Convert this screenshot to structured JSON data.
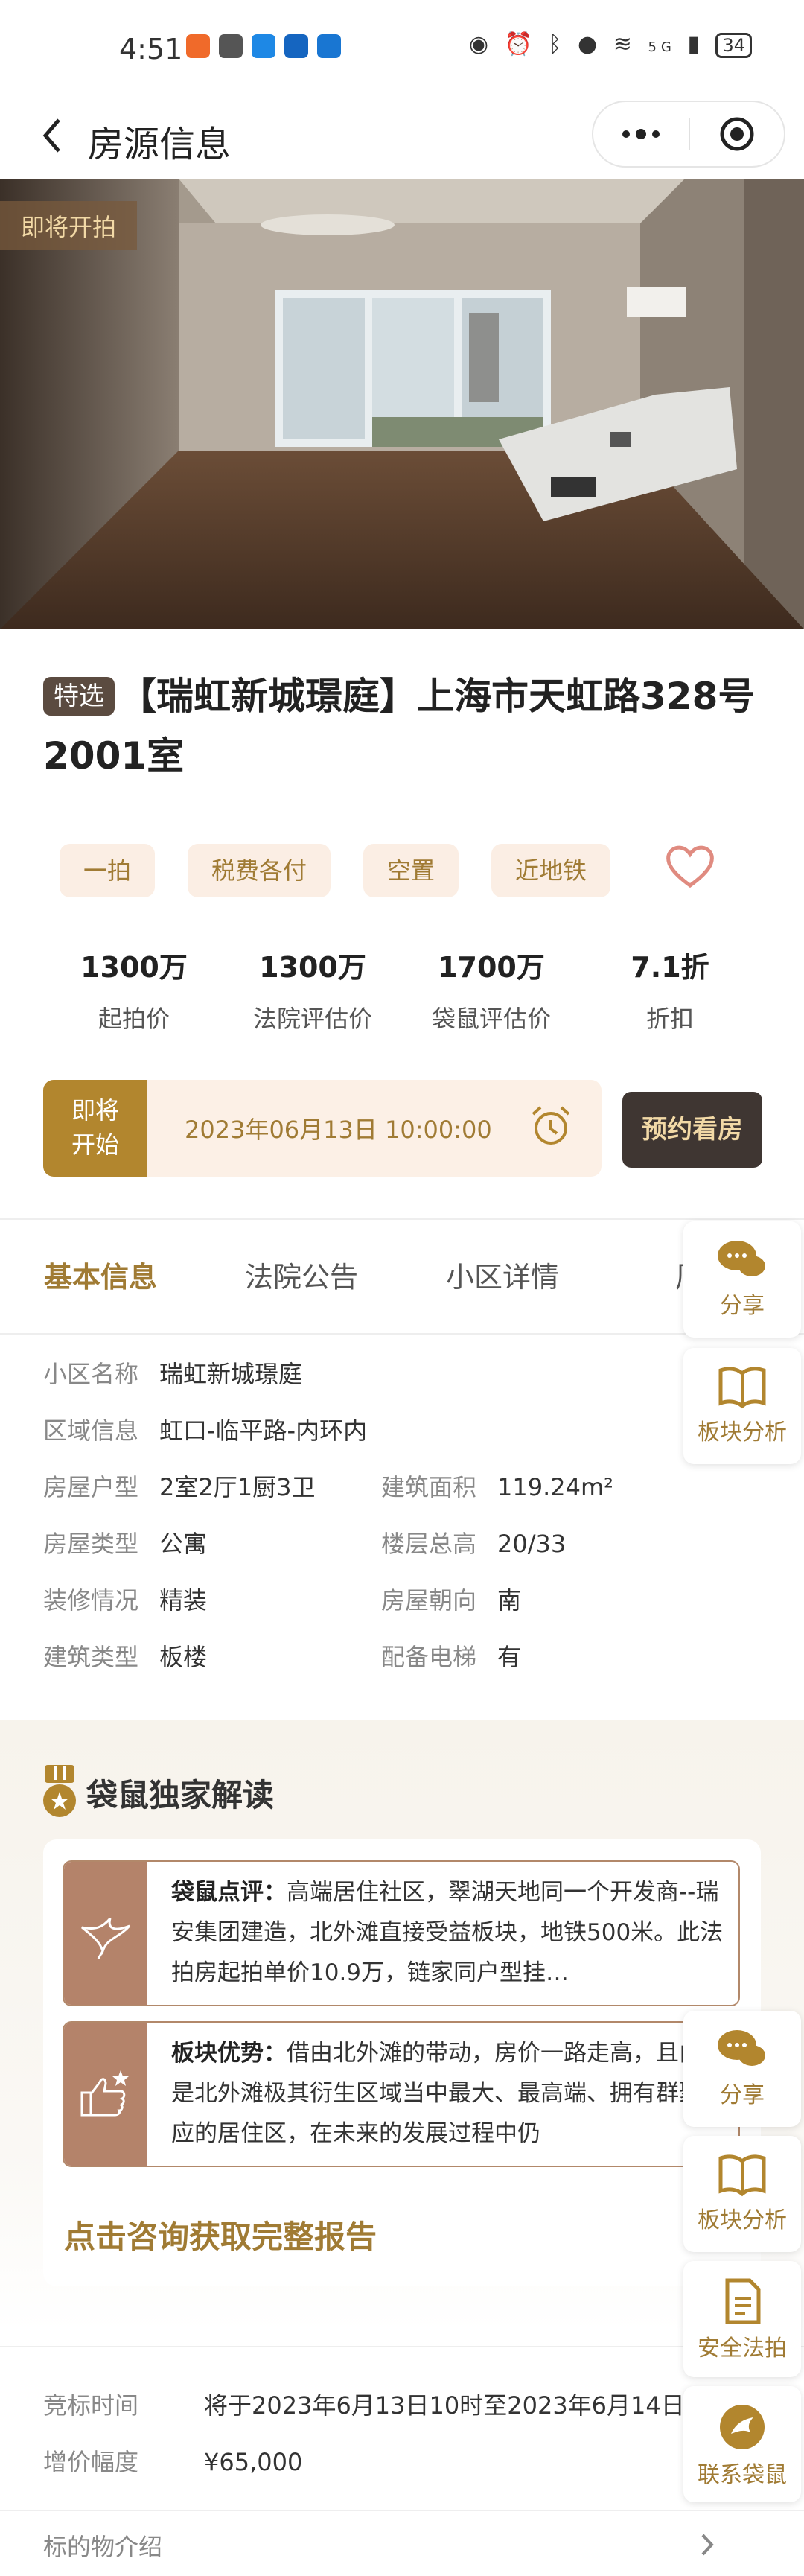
{
  "status_bar": {
    "time": "4:51",
    "battery": "34",
    "network": "5G"
  },
  "nav": {
    "title": "房源信息"
  },
  "hero": {
    "badge": "即将开拍"
  },
  "title": {
    "tag": "特选",
    "text": "【瑞虹新城璟庭】上海市天虹路328号2001室"
  },
  "tags": [
    "一拍",
    "税费各付",
    "空置",
    "近地铁"
  ],
  "stats": [
    {
      "value": "1300万",
      "label": "起拍价"
    },
    {
      "value": "1300万",
      "label": "法院评估价"
    },
    {
      "value": "1700万",
      "label": "袋鼠评估价"
    },
    {
      "value": "7.1折",
      "label": "折扣"
    }
  ],
  "countdown": {
    "status_line1": "即将",
    "status_line2": "开始",
    "time": "2023年06月13日 10:00:00"
  },
  "visit_button": "预约看房",
  "tabs": [
    "基本信息",
    "法院公告",
    "小区详情",
    "周边"
  ],
  "info": {
    "community_label": "小区名称",
    "community_value": "瑞虹新城璟庭",
    "region_label": "区域信息",
    "region_value": "虹口-临平路-内环内",
    "layout_label": "房屋户型",
    "layout_value": "2室2厅1厨3卫",
    "area_label": "建筑面积",
    "area_value": "119.24m²",
    "type_label": "房屋类型",
    "type_value": "公寓",
    "floor_label": "楼层总高",
    "floor_value": "20/33",
    "decor_label": "装修情况",
    "decor_value": "精装",
    "orient_label": "房屋朝向",
    "orient_value": "南",
    "build_label": "建筑类型",
    "build_value": "板楼",
    "elevator_label": "配备电梯",
    "elevator_value": "有"
  },
  "exclusive": {
    "title": "袋鼠独家解读",
    "review1_label": "袋鼠点评：",
    "review1_text": "高端居住社区，翠湖天地同一个开发商--瑞安集团建造，北外滩直接受益板块，地铁500米。此法拍房起拍单价10.9万，链家同户型挂…",
    "review2_label": "板块优势：",
    "review2_text": "借由北外滩的带动，房价一路走高，且由于是北外滩极其衍生区域当中最大、最高端、拥有群聚效应的居住区，在未来的发展过程中仍",
    "cta": "点击咨询获取完整报告"
  },
  "bid": {
    "time_label": "竞标时间",
    "time_value": "将于2023年6月13日10时至2023年6月14日10时",
    "increment_label": "增价幅度",
    "increment_value": "¥65,000",
    "subject_label": "标的物介绍"
  },
  "float_buttons": {
    "share": "分享",
    "analysis": "板块分析",
    "legal": "安全法拍",
    "contact": "联系袋鼠"
  },
  "colors": {
    "accent": "#a07b34",
    "tag_bg": "#fbeee4",
    "dark_btn": "#3f3632",
    "countdown_bg": "#b2862e"
  }
}
